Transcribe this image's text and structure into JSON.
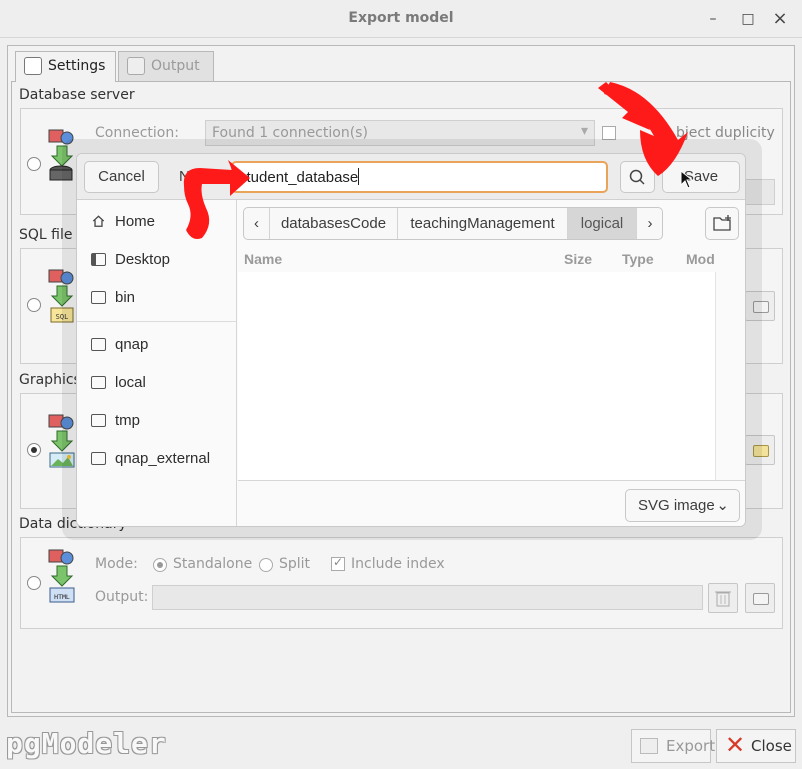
{
  "window": {
    "title": "Export model",
    "minimize": "–",
    "maximize": "□",
    "close": "×"
  },
  "tabs": [
    {
      "label": "Settings"
    },
    {
      "label": "Output"
    }
  ],
  "sections": {
    "database_server": {
      "label": "Database server",
      "connection_label": "Connection:",
      "connection_value": "Found 1 connection(s)",
      "duplicity_label": "bject duplicity"
    },
    "sql_file": {
      "label": "SQL file"
    },
    "graphics": {
      "label": "Graphics"
    },
    "data_dictionary": {
      "label": "Data dictionary",
      "mode_label": "Mode:",
      "standalone_label": "Standalone",
      "split_label": "Split",
      "include_index_label": "Include index",
      "output_label": "Output:"
    }
  },
  "icons": {
    "db_section": "database-export-icon",
    "sql_section": "sql-export-icon",
    "graphics_section": "image-export-icon",
    "dict_section": "html-export-icon"
  },
  "footer": {
    "logo": "pgModeler",
    "export_label": "Export",
    "close_label": "Close"
  },
  "file_dialog": {
    "cancel_label": "Cancel",
    "name_label": "Name",
    "name_value": "student_database",
    "save_label": "Save",
    "places": [
      {
        "label": "Home",
        "icon": "home-icon"
      },
      {
        "label": "Desktop",
        "icon": "desktop-icon"
      },
      {
        "label": "bin",
        "icon": "folder-icon"
      },
      {
        "label": "qnap",
        "icon": "folder-icon"
      },
      {
        "label": "local",
        "icon": "folder-icon"
      },
      {
        "label": "tmp",
        "icon": "folder-icon"
      },
      {
        "label": "qnap_external",
        "icon": "folder-icon"
      }
    ],
    "path": [
      "databasesCode",
      "teachingManagement",
      "logical"
    ],
    "columns": {
      "name": "Name",
      "size": "Size",
      "type": "Type",
      "modified": "Mod"
    },
    "filter_value": "SVG image"
  },
  "colors": {
    "accent_focus": "#e9a45a",
    "annotation_red": "#ff1a1a"
  }
}
